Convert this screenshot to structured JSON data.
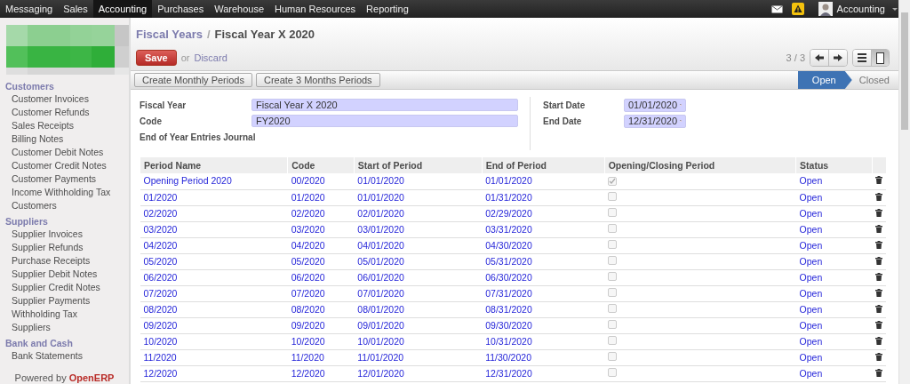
{
  "menu_bar": {
    "items": [
      {
        "label": "Messaging",
        "selected": false
      },
      {
        "label": "Sales",
        "selected": false
      },
      {
        "label": "Accounting",
        "selected": true
      },
      {
        "label": "Purchases",
        "selected": false
      },
      {
        "label": "Warehouse",
        "selected": false
      },
      {
        "label": "Human Resources",
        "selected": false
      },
      {
        "label": "Reporting",
        "selected": false
      }
    ],
    "user_menu": "Accounting"
  },
  "sidebar": {
    "sections": [
      {
        "title": "Customers",
        "items": [
          "Customer Invoices",
          "Customer Refunds",
          "Sales Receipts",
          "Billing Notes",
          "Customer Debit Notes",
          "Customer Credit Notes",
          "Customer Payments",
          "Income Withholding Tax",
          "Customers"
        ]
      },
      {
        "title": "Suppliers",
        "items": [
          "Supplier Invoices",
          "Supplier Refunds",
          "Purchase Receipts",
          "Supplier Debit Notes",
          "Supplier Credit Notes",
          "Supplier Payments",
          "Withholding Tax",
          "Suppliers"
        ]
      },
      {
        "title": "Bank and Cash",
        "items": [
          "Bank Statements"
        ]
      }
    ],
    "footer": {
      "prefix": "Powered by",
      "brand": "OpenERP"
    }
  },
  "breadcrumb": {
    "parent": "Fiscal Years",
    "separator": "/",
    "current": "Fiscal Year X 2020"
  },
  "edit_actions": {
    "save": "Save",
    "or": "or",
    "discard": "Discard"
  },
  "pager": "3 / 3",
  "views": [
    {
      "kind": "list",
      "selected": false
    },
    {
      "kind": "form",
      "selected": true
    }
  ],
  "action_buttons": [
    "Create Monthly Periods",
    "Create 3 Months Periods"
  ],
  "stages": [
    {
      "label": "Open",
      "selected": true
    },
    {
      "label": "Closed",
      "selected": false
    }
  ],
  "form": {
    "left": [
      {
        "label": "Fiscal Year",
        "value": "Fiscal Year X 2020"
      },
      {
        "label": "Code",
        "value": "FY2020"
      },
      {
        "label": "End of Year Entries Journal"
      }
    ],
    "right": [
      {
        "label": "Start Date",
        "value": "01/01/2020"
      },
      {
        "label": "End Date",
        "value": "12/31/2020"
      }
    ]
  },
  "table": {
    "columns": [
      "Period Name",
      "Code",
      "Start of Period",
      "End of Period",
      "Opening/Closing Period",
      "Status"
    ],
    "rows": [
      {
        "cells": [
          "Opening Period 2020",
          "00/2020",
          "01/01/2020",
          "01/01/2020"
        ],
        "checked": true,
        "status": "Open"
      },
      {
        "cells": [
          "01/2020",
          "01/2020",
          "01/01/2020",
          "01/31/2020"
        ],
        "checked": false,
        "status": "Open"
      },
      {
        "cells": [
          "02/2020",
          "02/2020",
          "02/01/2020",
          "02/29/2020"
        ],
        "checked": false,
        "status": "Open"
      },
      {
        "cells": [
          "03/2020",
          "03/2020",
          "03/01/2020",
          "03/31/2020"
        ],
        "checked": false,
        "status": "Open"
      },
      {
        "cells": [
          "04/2020",
          "04/2020",
          "04/01/2020",
          "04/30/2020"
        ],
        "checked": false,
        "status": "Open"
      },
      {
        "cells": [
          "05/2020",
          "05/2020",
          "05/01/2020",
          "05/31/2020"
        ],
        "checked": false,
        "status": "Open"
      },
      {
        "cells": [
          "06/2020",
          "06/2020",
          "06/01/2020",
          "06/30/2020"
        ],
        "checked": false,
        "status": "Open"
      },
      {
        "cells": [
          "07/2020",
          "07/2020",
          "07/01/2020",
          "07/31/2020"
        ],
        "checked": false,
        "status": "Open"
      },
      {
        "cells": [
          "08/2020",
          "08/2020",
          "08/01/2020",
          "08/31/2020"
        ],
        "checked": false,
        "status": "Open"
      },
      {
        "cells": [
          "09/2020",
          "09/2020",
          "09/01/2020",
          "09/30/2020"
        ],
        "checked": false,
        "status": "Open"
      },
      {
        "cells": [
          "10/2020",
          "10/2020",
          "10/01/2020",
          "10/31/2020"
        ],
        "checked": false,
        "status": "Open"
      },
      {
        "cells": [
          "11/2020",
          "11/2020",
          "11/01/2020",
          "11/30/2020"
        ],
        "checked": false,
        "status": "Open"
      },
      {
        "cells": [
          "12/2020",
          "12/2020",
          "12/01/2020",
          "12/31/2020"
        ],
        "checked": false,
        "status": "Open"
      }
    ]
  }
}
